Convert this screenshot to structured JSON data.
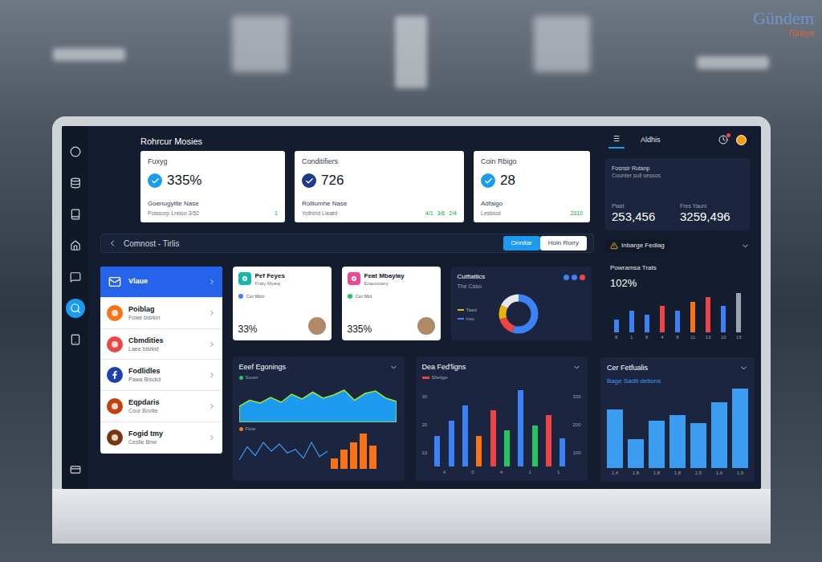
{
  "watermark": {
    "title": "Gündem",
    "subtitle": "Türkiye"
  },
  "header": {
    "title": "Rohrcur Mosies"
  },
  "rail": [
    {
      "selected": false
    },
    {
      "selected": false
    },
    {
      "selected": false
    },
    {
      "selected": false
    },
    {
      "selected": false
    },
    {
      "selected": true
    },
    {
      "selected": false
    },
    {
      "selected": false
    }
  ],
  "stat_cards": [
    {
      "label": "Fuxyg",
      "value": "335%",
      "subtitle": "Goenugyitle Nase",
      "footer": "Poissorp Lreioo 3/52",
      "badges": [
        "1"
      ],
      "color": "#1d9bf0"
    },
    {
      "label": "Conditifiers",
      "value": "726",
      "subtitle": "Rolliumhe Nase",
      "footer": "Yothirid Lieatd",
      "badges": [
        "4/1",
        "3/6",
        "2/4"
      ],
      "color": "#1e3a8a"
    },
    {
      "label": "Coin Rbigo",
      "value": "28",
      "subtitle": "Adfaigo",
      "footer": "Lesbiod",
      "badges": [
        "2310"
      ],
      "color": "#1d9bf0"
    }
  ],
  "nav": {
    "title": "Comnost - Tirlis",
    "buttons": [
      {
        "label": "Onnitar",
        "selected": true
      },
      {
        "label": "Hoin Rorry",
        "selected": false
      }
    ]
  },
  "list": {
    "items": [
      {
        "name": "Vlaue",
        "subtitle": "",
        "color": "#ffffff",
        "selected": true
      },
      {
        "name": "Poiblag",
        "subtitle": "Fowe bisrkin",
        "color": "#f97316",
        "selected": false
      },
      {
        "name": "Cbmdities",
        "subtitle": "Laee bisrkid",
        "color": "#ef4444",
        "selected": false
      },
      {
        "name": "Fodlidles",
        "subtitle": "Pawa Bisckd",
        "color": "#1e40af",
        "selected": false
      },
      {
        "name": "Eqpdaris",
        "subtitle": "Cour Bovtle",
        "color": "#c2410c",
        "selected": false
      },
      {
        "name": "Fogid tmy",
        "subtitle": "Ceslie Bnw",
        "color": "#78350f",
        "selected": false
      }
    ]
  },
  "mini_cards": [
    {
      "title": "Pef Feyes",
      "subtitle": "Fraty Myaiq",
      "metric": "Cor Mctr",
      "value": "33%",
      "color": "#14b8a6",
      "dot": "#3b82f6"
    },
    {
      "title": "Feat Mbaylay",
      "subtitle": "Enaunctery",
      "metric": "Cor Mct",
      "value": "335%",
      "color": "#ec4899",
      "dot": "#22c55e"
    }
  ],
  "donut": {
    "title": "Cutfiatiics",
    "subtitle": "The Caso",
    "dots": [
      {
        "color": "#3b82f6"
      },
      {
        "color": "#3b82f6"
      },
      {
        "color": "#ef4444"
      }
    ],
    "legend": [
      {
        "label": "Taad",
        "color": "#eab308"
      },
      {
        "label": "Ireo",
        "color": "#3b82f6"
      }
    ],
    "segments": [
      {
        "value": 55,
        "color": "#3b82f6"
      },
      {
        "value": 15,
        "color": "#ef4444"
      },
      {
        "value": 12,
        "color": "#eab308"
      },
      {
        "value": 18,
        "color": "#e5e7eb"
      }
    ]
  },
  "earnings_chart": {
    "title": "Eeef Egonings",
    "legend": {
      "label": "Souer",
      "color": "#22c55e"
    },
    "area": [
      40,
      55,
      48,
      62,
      50,
      70,
      58,
      75,
      60,
      68,
      80,
      55,
      72,
      78,
      60,
      52
    ],
    "legend2": {
      "label": "Flow",
      "color": "#f97316"
    },
    "line": [
      10,
      25,
      15,
      30,
      20,
      28,
      18,
      22,
      12,
      30,
      14,
      20
    ],
    "bars": [
      12,
      22,
      30,
      40,
      26
    ]
  },
  "feed_chart": {
    "title": "Dea Fed'ligns",
    "legend": {
      "label": "Sbelige",
      "color": "#ef4444"
    },
    "left_ticks": [
      "30",
      "20",
      "10"
    ],
    "right_ticks": [
      "330",
      "200",
      "100"
    ],
    "x_ticks": [
      "4",
      "0",
      "4",
      "1",
      "1"
    ],
    "bars": [
      {
        "value": 12,
        "color": "#3b82f6"
      },
      {
        "value": 18,
        "color": "#3b82f6"
      },
      {
        "value": 24,
        "color": "#3b82f6"
      },
      {
        "value": 12,
        "color": "#f97316"
      },
      {
        "value": 22,
        "color": "#ef4444"
      },
      {
        "value": 14,
        "color": "#22c55e"
      },
      {
        "value": 30,
        "color": "#3b82f6"
      },
      {
        "value": 16,
        "color": "#22c55e"
      },
      {
        "value": 20,
        "color": "#ef4444"
      },
      {
        "value": 11,
        "color": "#3b82f6"
      }
    ]
  },
  "top_bar": {
    "tabs": [
      {
        "label": "☰",
        "selected": true
      },
      {
        "label": "Aldhis",
        "selected": false
      }
    ],
    "notification": true
  },
  "summary": {
    "title": "Fosnsir Rutanp",
    "subtitle": "Counter sull sessos",
    "stats": [
      {
        "label": "Plast",
        "value": "253,456"
      },
      {
        "label": "Fres Yauni",
        "value": "3259,496"
      }
    ]
  },
  "alert": {
    "label": "Inbarge Fedlag"
  },
  "trend": {
    "title": "Powramsa Trats",
    "value": "102%",
    "bars": [
      {
        "value": 3,
        "color": "#3b82f6"
      },
      {
        "value": 5,
        "color": "#3b82f6"
      },
      {
        "value": 4,
        "color": "#3b82f6"
      },
      {
        "value": 6,
        "color": "#ef4444"
      },
      {
        "value": 5,
        "color": "#3b82f6"
      },
      {
        "value": 7,
        "color": "#f97316"
      },
      {
        "value": 8,
        "color": "#ef4444"
      },
      {
        "value": 6,
        "color": "#3b82f6"
      },
      {
        "value": 9,
        "color": "#9ca3af"
      }
    ],
    "x_ticks": [
      "8",
      "1",
      "8",
      "4",
      "8",
      "11",
      "13",
      "10",
      "15"
    ]
  },
  "features_chart": {
    "title": "Cer Fetfualis",
    "subtitle": "Bage Sadit detions",
    "bars": [
      22,
      11,
      18,
      20,
      17,
      25,
      30
    ],
    "x_ticks": [
      "1,4",
      "1,8",
      "1,8",
      "1,8",
      "1,5",
      "1,6",
      "1,9"
    ]
  }
}
